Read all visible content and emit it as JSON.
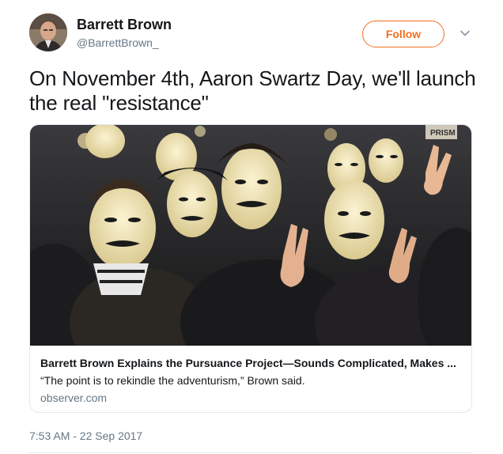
{
  "author": {
    "name": "Barrett Brown",
    "handle": "@BarrettBrown_"
  },
  "follow_button": {
    "label": "Follow"
  },
  "tweet": {
    "text": "On November 4th, Aaron Swartz Day, we'll launch the real \"resistance\"",
    "timestamp": "7:53 AM - 22 Sep 2017"
  },
  "card": {
    "title": "Barrett Brown Explains the Pursuance Project—Sounds Complicated, Makes ...",
    "description": "“The point is to rekindle the adventurism,” Brown said.",
    "domain": "observer.com",
    "image_overlay_text": "PRISM"
  },
  "icons": {
    "menu": "chevron-down-icon"
  },
  "colors": {
    "accent": "#f36f21",
    "text_primary": "#14171a",
    "text_secondary": "#657786",
    "border": "#e1e8ed"
  }
}
